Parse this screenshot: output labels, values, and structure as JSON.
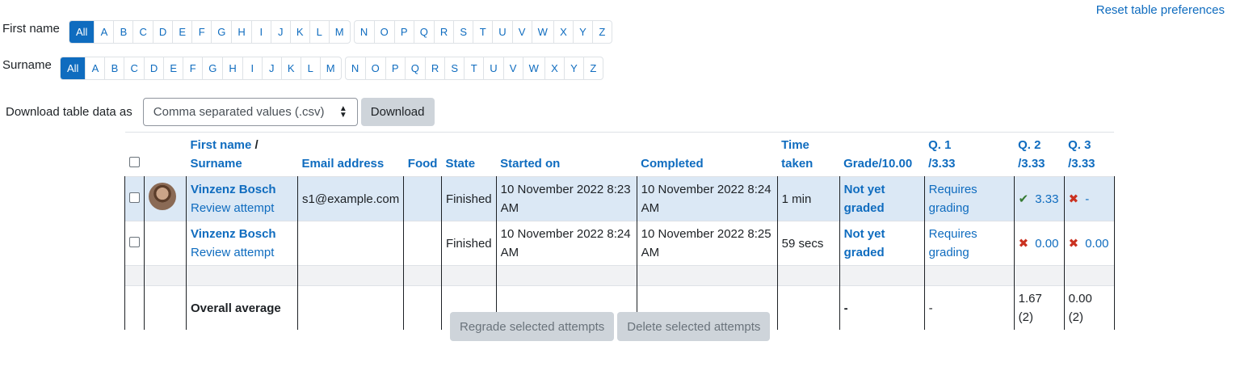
{
  "reset_link": "Reset table preferences",
  "initials_filter": {
    "first_name_label": "First name",
    "surname_label": "Surname",
    "all_label": "All",
    "letters_group1": [
      "A",
      "B",
      "C",
      "D",
      "E",
      "F",
      "G",
      "H",
      "I",
      "J",
      "K",
      "L",
      "M"
    ],
    "letters_group2": [
      "N",
      "O",
      "P",
      "Q",
      "R",
      "S",
      "T",
      "U",
      "V",
      "W",
      "X",
      "Y",
      "Z"
    ]
  },
  "download": {
    "label": "Download table data as",
    "format_selected": "Comma separated values (.csv)",
    "button_label": "Download"
  },
  "table": {
    "headers": {
      "first_name": "First name",
      "name_sep": " /",
      "surname": "Surname",
      "email": "Email address",
      "food": "Food",
      "state": "State",
      "started": "Started on",
      "completed": "Completed",
      "time_taken_1": "Time",
      "time_taken_2": "taken",
      "grade": "Grade/10.00",
      "q1_1": "Q. 1",
      "q1_2": "/3.33",
      "q2_1": "Q. 2",
      "q2_2": "/3.33",
      "q3_1": "Q. 3",
      "q3_2": "/3.33"
    },
    "rows": [
      {
        "name": "Vinzenz Bosch",
        "review": "Review attempt",
        "email": "s1@example.com",
        "food": "",
        "state": "Finished",
        "started": "10 November 2022 8:23 AM",
        "completed": "10 November 2022 8:24 AM",
        "time_taken": "1 min",
        "grade_1": "Not yet",
        "grade_2": "graded",
        "q1_1": "Requires",
        "q1_2": "grading",
        "q2": "3.33",
        "q2_status": "correct",
        "q3": "-",
        "q3_status": "incorrect"
      },
      {
        "name": "Vinzenz Bosch",
        "review": "Review attempt",
        "email": "",
        "food": "",
        "state": "Finished",
        "started": "10 November 2022 8:24 AM",
        "completed": "10 November 2022 8:25 AM",
        "time_taken": "59 secs",
        "grade_1": "Not yet",
        "grade_2": "graded",
        "q1_1": "Requires",
        "q1_2": "grading",
        "q2": "0.00",
        "q2_status": "incorrect",
        "q3": "0.00",
        "q3_status": "incorrect"
      }
    ],
    "average": {
      "label": "Overall average",
      "grade": "-",
      "q1": "-",
      "q2": "1.67 (2)",
      "q3": "0.00 (2)"
    }
  },
  "actions": {
    "regrade": "Regrade selected attempts",
    "delete": "Delete selected attempts"
  },
  "icons": {
    "correct": "check-icon",
    "incorrect": "cross-icon"
  },
  "colors": {
    "link": "#0f6cbf",
    "row_highlight": "#dbe8f5",
    "correct": "#357a32",
    "incorrect": "#ca3120"
  }
}
